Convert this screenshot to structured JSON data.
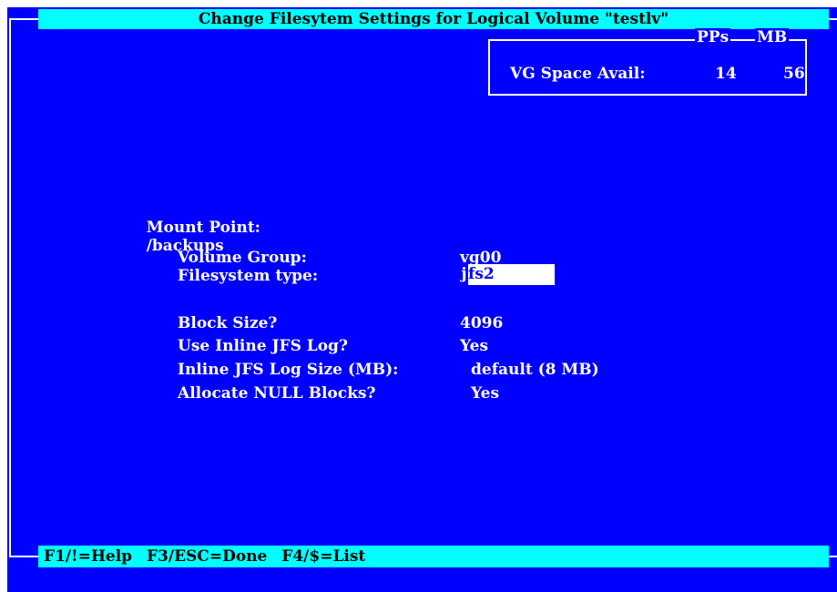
{
  "title": "Change Filesytem Settings for Logical Volume \"testlv\"",
  "vg_space": {
    "label": "VG Space Avail:",
    "pps_header": "PPs",
    "mb_header": "MB",
    "pps_value": "14",
    "mb_value": "56"
  },
  "mount_point": {
    "label": "Mount Point:",
    "value": "/backups"
  },
  "fields": {
    "volume_group": {
      "label": "Volume Group:",
      "value": "vg00"
    },
    "filesystem_type": {
      "label": "Filesystem type:",
      "cursor_char": "j",
      "value_rest": "fs2"
    },
    "block_size": {
      "label": "Block Size?",
      "value": "4096"
    },
    "inline_log": {
      "label": "Use Inline JFS Log?",
      "value": "Yes"
    },
    "inline_log_size": {
      "label": "Inline JFS Log Size (MB):",
      "value": "default (8 MB)"
    },
    "null_blocks": {
      "label": "Allocate NULL Blocks?",
      "value": "Yes"
    }
  },
  "footer": {
    "help": "F1/!=Help",
    "done": "F3/ESC=Done",
    "list": "F4/$=List"
  },
  "colors": {
    "background": "#0000ff",
    "bar": "#00ffff",
    "text": "#ffffff"
  }
}
